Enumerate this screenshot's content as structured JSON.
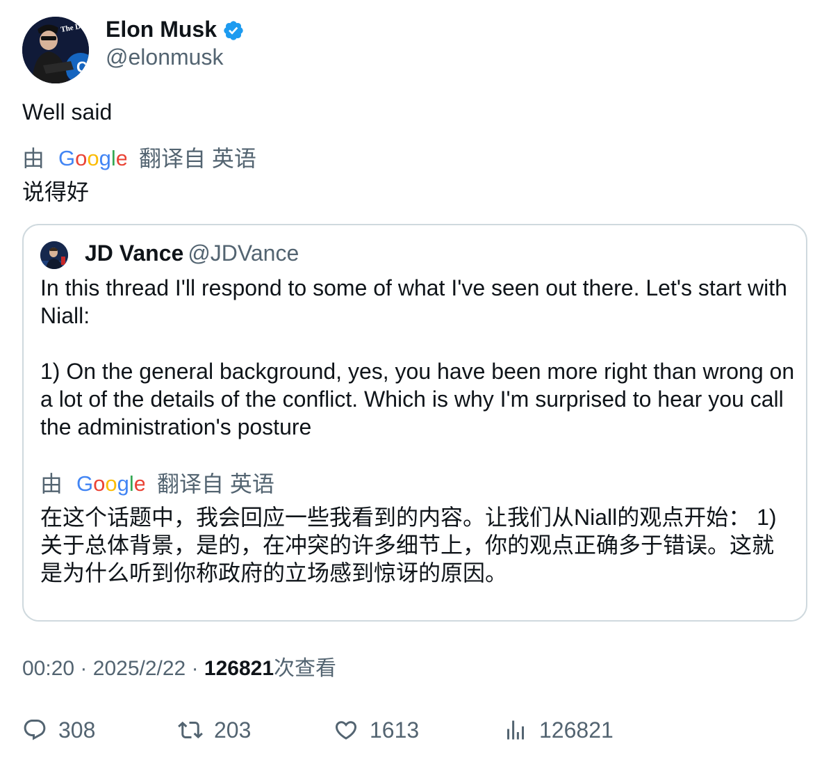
{
  "tweet": {
    "author_name": "Elon Musk",
    "author_handle": "@elonmusk",
    "avatar_text": "The Dogefather",
    "text": "Well said",
    "translation": {
      "prefix": "由",
      "provider": "Google",
      "suffix": "翻译自 英语",
      "text": "说得好"
    }
  },
  "quote": {
    "author_name": "JD Vance",
    "author_handle": "@JDVance",
    "text": "In this thread I'll respond to some of what I've seen out there. Let's start with Niall:\n\n1) On the general background, yes, you have been more right than wrong on a lot of the details of the conflict. Which is why I'm surprised to hear you call the administration's posture",
    "translation": {
      "prefix": "由",
      "provider": "Google",
      "suffix": "翻译自 英语",
      "text": "在这个话题中，我会回应一些我看到的内容。让我们从Niall的观点开始： 1) 关于总体背景，是的，在冲突的许多细节上，你的观点正确多于错误。这就是为什么听到你称政府的立场感到惊讶的原因。"
    }
  },
  "meta": {
    "time": "00:20",
    "separator": "·",
    "date": "2025/2/22",
    "views": "126821",
    "views_label": "次查看"
  },
  "actions": {
    "reply_count": "308",
    "retweet_count": "203",
    "like_count": "1613",
    "views_count": "126821",
    "icons": [
      "reply-icon",
      "retweet-icon",
      "like-icon",
      "analytics-icon"
    ]
  },
  "colors": {
    "text": "#0f1419",
    "secondary": "#536471",
    "verified": "#1d9bf0",
    "border": "#cfd9de",
    "google_blue": "#4285f4",
    "google_red": "#ea4335",
    "google_yellow": "#fbbc05",
    "google_green": "#34a853"
  }
}
